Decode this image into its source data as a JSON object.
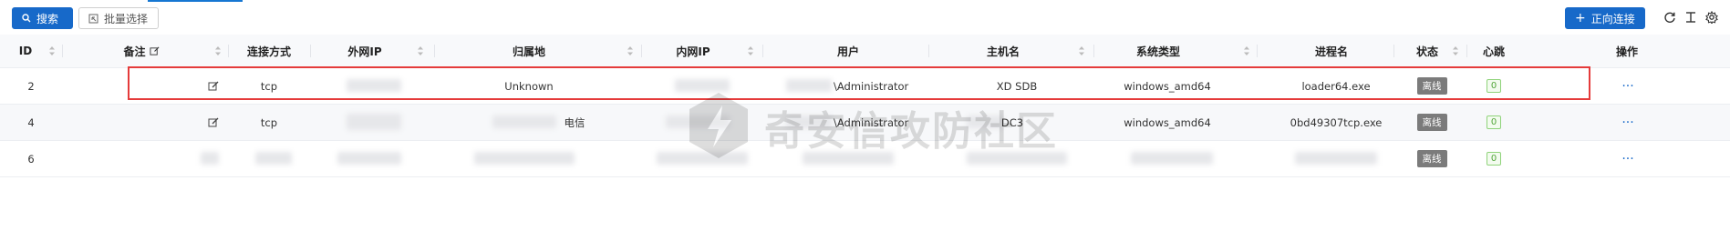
{
  "toolbar": {
    "search_label": "搜索",
    "batch_label": "批量选择",
    "forward_label": "正向连接",
    "icons": [
      "search-icon",
      "batch-select-icon",
      "plus-icon",
      "refresh-icon",
      "density-icon",
      "settings-icon"
    ]
  },
  "columns": {
    "id": "ID",
    "note": "备注",
    "connect_type": "连接方式",
    "ext_ip": "外网IP",
    "location": "归属地",
    "int_ip": "内网IP",
    "user": "用户",
    "host": "主机名",
    "os": "系统类型",
    "process": "进程名",
    "status": "状态",
    "heartbeat": "心跳",
    "action": "操作"
  },
  "rows": [
    {
      "id": "2",
      "connect_type": "tcp",
      "location": "Unknown",
      "user": "\\Administrator",
      "host": "XD      SDB",
      "os": "windows_amd64",
      "process": "loader64.exe",
      "status": "离线",
      "heartbeat": "0",
      "action": "···"
    },
    {
      "id": "4",
      "connect_type": "tcp",
      "location": "电信",
      "user": "\\Administrator",
      "host": "DC3",
      "os": "windows_amd64",
      "process": "0bd49307tcp.exe",
      "status": "离线",
      "heartbeat": "0",
      "action": "···"
    },
    {
      "id": "6",
      "connect_type": "",
      "location": "",
      "user": "",
      "host": "",
      "os": "",
      "process": "",
      "status": "离线",
      "heartbeat": "0",
      "action": "···"
    }
  ],
  "watermark": {
    "text": "奇安信攻防社区"
  },
  "colors": {
    "primary": "#1769c9",
    "highlight": "#e53b3b",
    "offline": "#7b7b7b",
    "heartbeat": "#52a63a"
  }
}
